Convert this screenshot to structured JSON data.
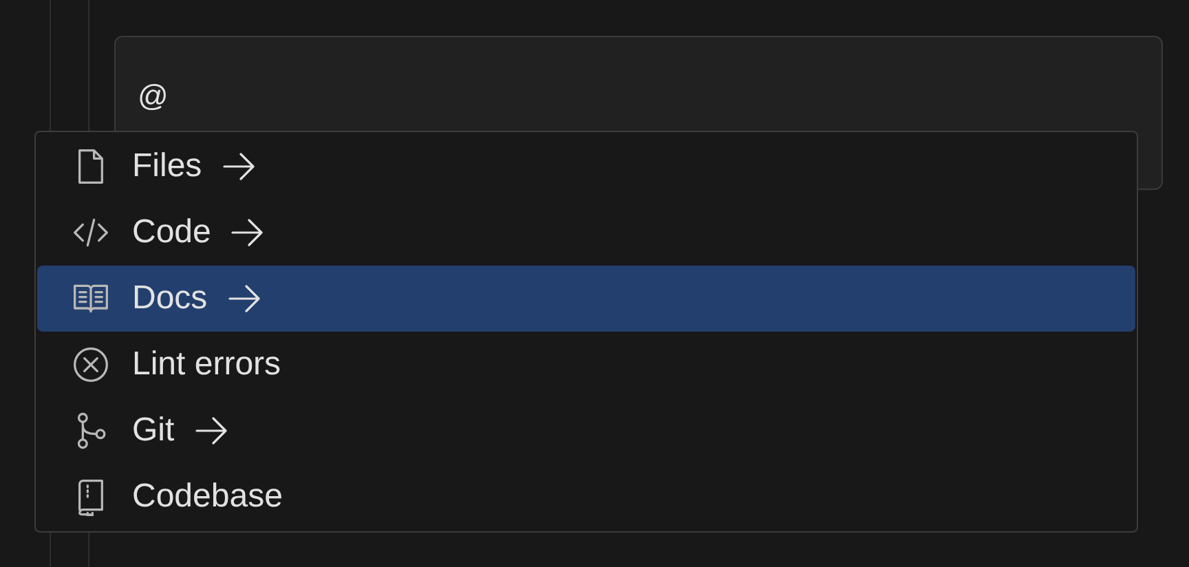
{
  "input": {
    "value": "@"
  },
  "menu": {
    "items": [
      {
        "kind": "file",
        "label": "Files",
        "submenu": true,
        "selected": false
      },
      {
        "kind": "code",
        "label": "Code",
        "submenu": true,
        "selected": false
      },
      {
        "kind": "docs",
        "label": "Docs",
        "submenu": true,
        "selected": true
      },
      {
        "kind": "error",
        "label": "Lint errors",
        "submenu": false,
        "selected": false
      },
      {
        "kind": "git",
        "label": "Git",
        "submenu": true,
        "selected": false
      },
      {
        "kind": "codebase",
        "label": "Codebase",
        "submenu": false,
        "selected": false
      }
    ]
  }
}
